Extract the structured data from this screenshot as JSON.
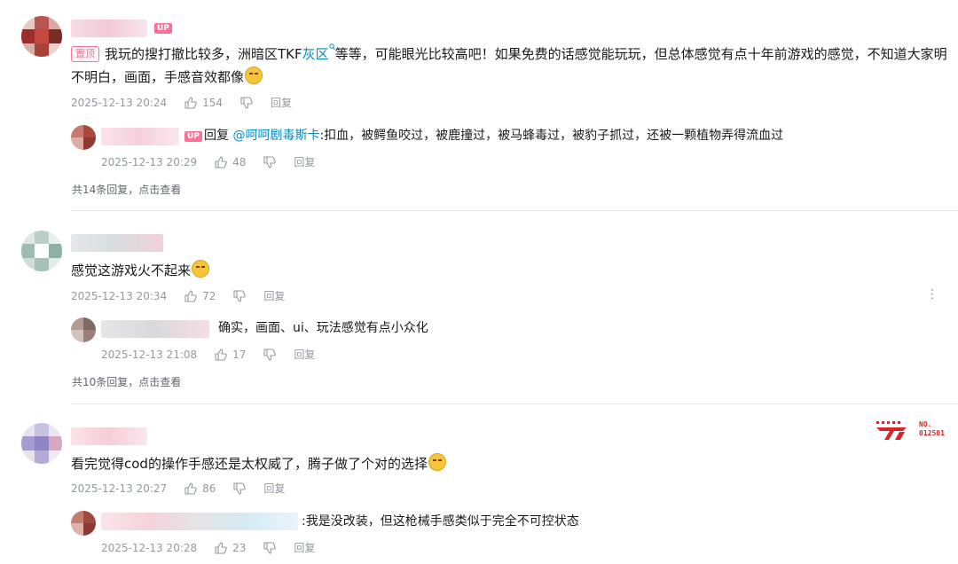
{
  "comments": [
    {
      "top_label": "置顶",
      "text_1": "我玩的搜打撤比较多，洲暗区TKF",
      "highlight": "灰区",
      "text_2": "等等，可能眼光比较高吧！如果免费的话感觉能玩玩，但总体感觉有点十年前游戏的感觉，不知道大家明不明白，画面，手感音效都像",
      "up_badge": "UP",
      "date": "2025-12-13 20:24",
      "likes": "154",
      "reply_label": "回复",
      "sub_reply": {
        "up_badge": "UP",
        "reply_word": "回复",
        "mention": "@呵呵剧毒斯卡",
        "text": ":扣血，被鳄鱼咬过，被鹿撞过，被马蜂毒过，被豹子抓过，还被一颗植物弄得流血过",
        "date": "2025-12-13 20:29",
        "likes": "48",
        "reply_label": "回复"
      },
      "more_replies": "共14条回复，点击查看"
    },
    {
      "text": "感觉这游戏火不起来",
      "date": "2025-12-13 20:34",
      "likes": "72",
      "reply_label": "回复",
      "sub_reply": {
        "text": "确实，画面、ui、玩法感觉有点小众化",
        "date": "2025-12-13 21:08",
        "likes": "17",
        "reply_label": "回复"
      },
      "more_replies": "共10条回复，点击查看"
    },
    {
      "text": "看完觉得cod的操作手感还是太权威了，腾子做了个对的选择",
      "date": "2025-12-13 20:27",
      "likes": "86",
      "reply_label": "回复",
      "fan_badge_no": "NO.",
      "fan_badge_num": "012501",
      "sub_reply": {
        "text": ":我是没改装，但这枪械手感类似于完全不可控状态",
        "date": "2025-12-13 20:28",
        "likes": "23",
        "reply_label": "回复"
      }
    }
  ],
  "colors": {
    "accent_pink": "#fb7299",
    "link_blue": "#008ac5",
    "meta_gray": "#9499a0"
  },
  "icons": [
    "thumbs-up-icon",
    "thumbs-down-icon",
    "more-vertical-icon",
    "emoji-icon",
    "search-link-icon",
    "fan-badge-icon"
  ]
}
